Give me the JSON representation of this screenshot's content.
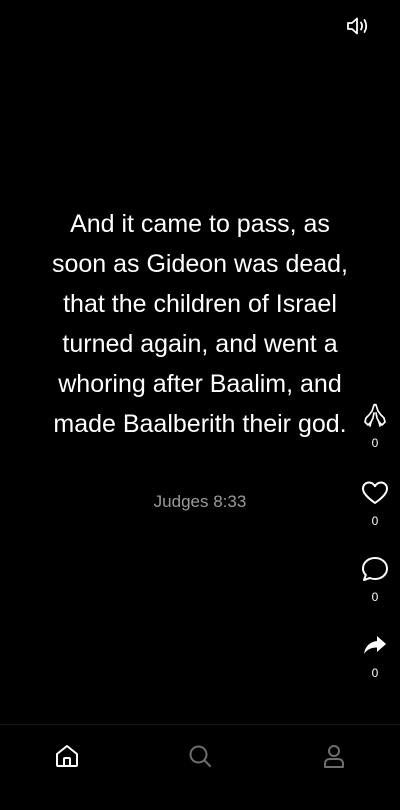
{
  "header": {
    "sound_icon": "speaker-volume-icon"
  },
  "verse": {
    "text": "And it came to pass, as soon as Gideon was dead, that the children of Israel turned again, and went a whoring after Baalim, and made Baalberith their god.",
    "reference": "Judges 8:33"
  },
  "actions": {
    "pray": {
      "icon": "praying-hands-icon",
      "count": "0"
    },
    "like": {
      "icon": "heart-icon",
      "count": "0"
    },
    "comment": {
      "icon": "comment-bubble-icon",
      "count": "0"
    },
    "share": {
      "icon": "share-arrow-icon",
      "count": "0"
    }
  },
  "bottom_nav": {
    "items": [
      {
        "name": "home",
        "icon": "home-icon",
        "active": true
      },
      {
        "name": "search",
        "icon": "search-icon",
        "active": false
      },
      {
        "name": "profile",
        "icon": "user-icon",
        "active": false
      }
    ]
  },
  "colors": {
    "background": "#000000",
    "text": "#ffffff",
    "muted": "#9a9a9a"
  }
}
